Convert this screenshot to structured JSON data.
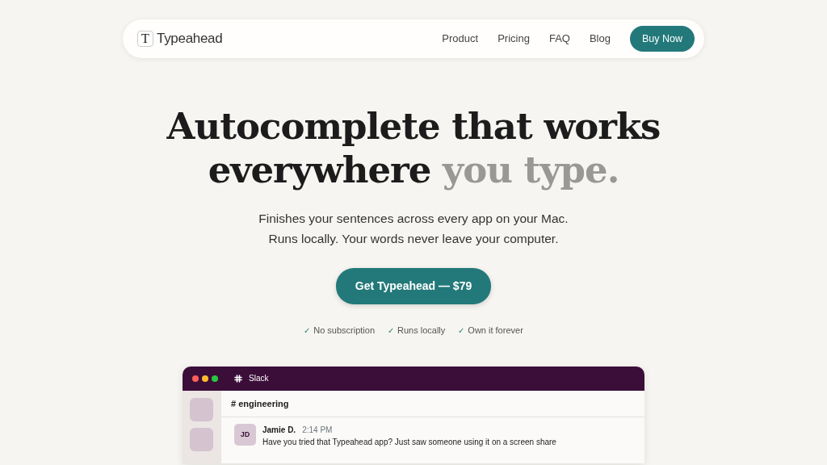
{
  "nav": {
    "logo_letter": "T",
    "brand": "Typeahead",
    "links": [
      "Product",
      "Pricing",
      "FAQ",
      "Blog"
    ],
    "cta": "Buy Now"
  },
  "hero": {
    "headline": [
      {
        "text": "Autocomplete that works",
        "muted": false
      },
      {
        "text": "everywhere",
        "muted": false
      },
      {
        "text": "you type.",
        "muted": true
      }
    ],
    "subtitle": [
      "Finishes your sentences across every app on your Mac.",
      "Runs locally. Your words never leave your computer."
    ],
    "cta": "Get Typeahead — $79",
    "perks": [
      {
        "mark": "✓",
        "label": "No subscription"
      },
      {
        "mark": "✓",
        "label": "Runs locally"
      },
      {
        "mark": "✓",
        "label": "Own it forever"
      }
    ]
  },
  "app_window": {
    "title": "Slack",
    "channel": "# engineering",
    "messages": [
      {
        "initials": "JD",
        "author": "Jamie D.",
        "time": "2:14 PM",
        "text": "Have you tried that Typeahead app? Just saw someone using it on a screen share"
      }
    ]
  }
}
